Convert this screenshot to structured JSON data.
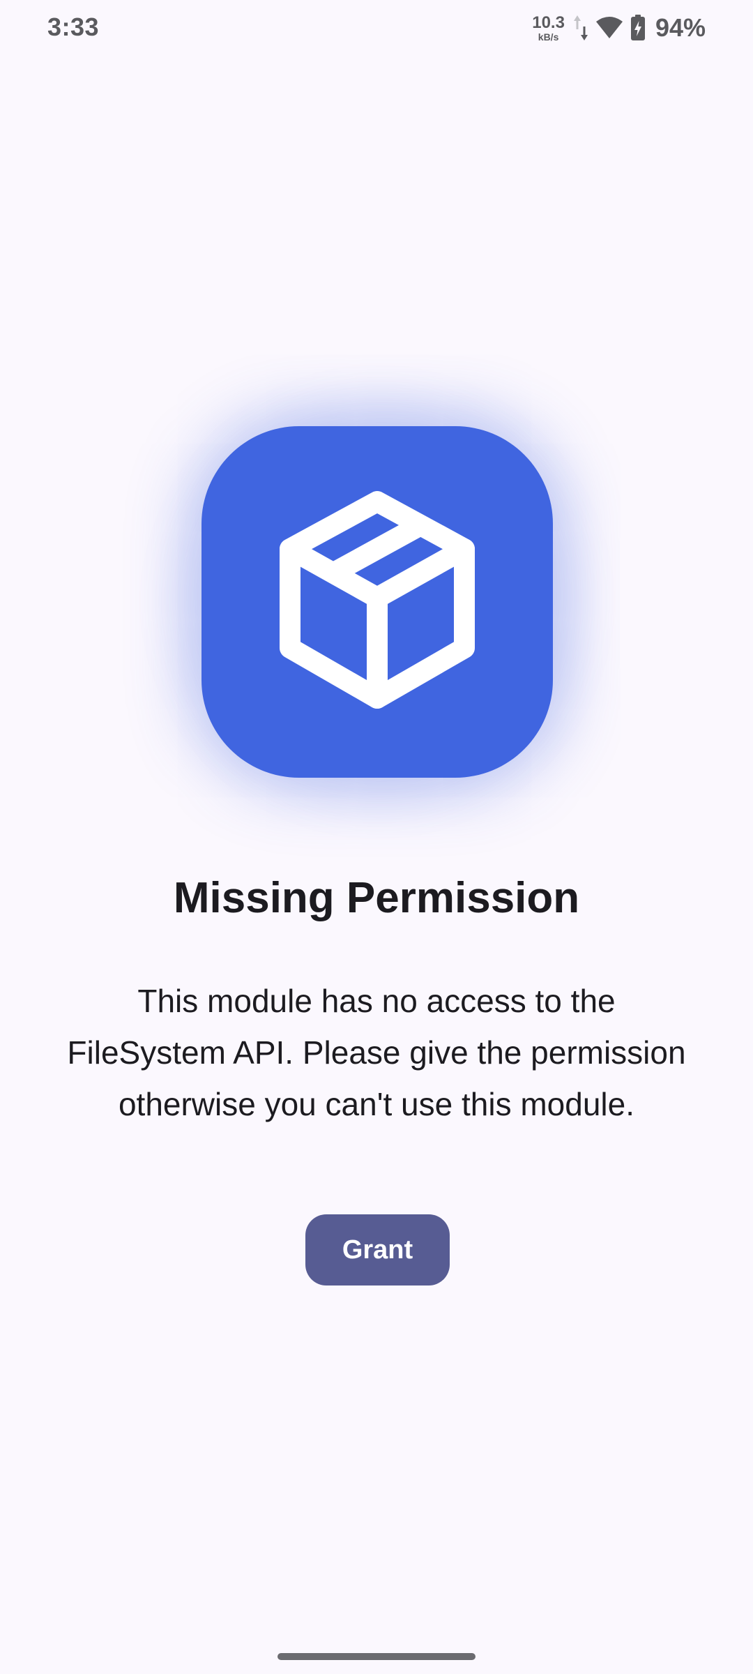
{
  "status_bar": {
    "time": "3:33",
    "net_speed_value": "10.3",
    "net_speed_unit": "kB/s",
    "battery_percent": "94%",
    "icons": [
      "data-transfer-icon",
      "wifi-icon",
      "battery-charging-icon"
    ]
  },
  "app_icon": {
    "icon": "package-box-icon",
    "background_color": "#4065e0"
  },
  "content": {
    "title": "Missing Permission",
    "message": "This module has no access to the FileSystem API. Please give the permission otherwise you can't use this module.",
    "grant_label": "Grant"
  },
  "colors": {
    "background": "#fbf8fe",
    "button": "#575c93",
    "text": "#1c1b20"
  }
}
